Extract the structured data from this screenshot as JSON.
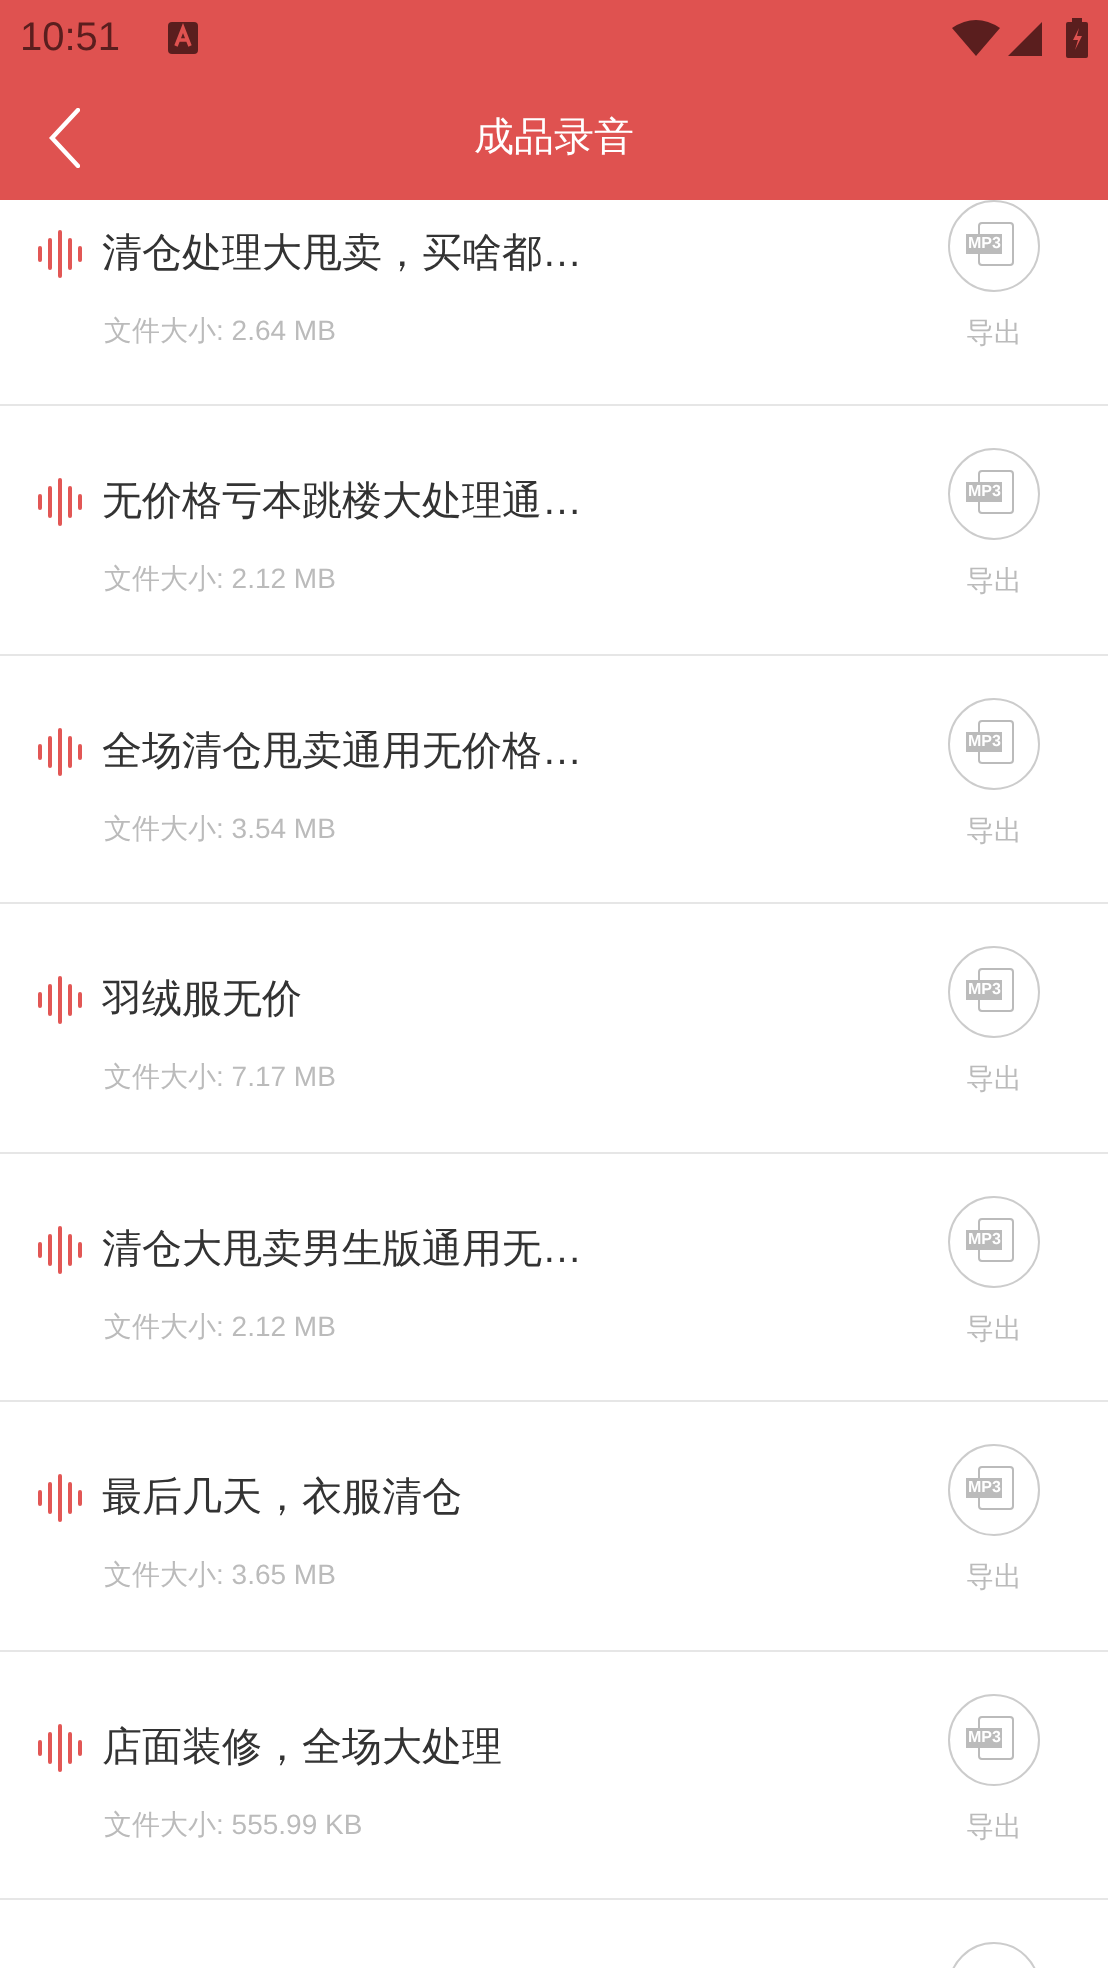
{
  "status_bar": {
    "time": "10:51"
  },
  "header": {
    "title": "成品录音"
  },
  "recordings": [
    {
      "title": "清仓处理大甩卖，买啥都…",
      "size": "文件大小: 2.64 MB",
      "icon_text": "MP3",
      "action": "导出"
    },
    {
      "title": "无价格亏本跳楼大处理通…",
      "size": "文件大小: 2.12 MB",
      "icon_text": "MP3",
      "action": "导出"
    },
    {
      "title": "全场清仓甩卖通用无价格…",
      "size": "文件大小: 3.54 MB",
      "icon_text": "MP3",
      "action": "导出"
    },
    {
      "title": "羽绒服无价",
      "size": "文件大小: 7.17 MB",
      "icon_text": "MP3",
      "action": "导出"
    },
    {
      "title": "清仓大甩卖男生版通用无…",
      "size": "文件大小: 2.12 MB",
      "icon_text": "MP3",
      "action": "导出"
    },
    {
      "title": "最后几天，衣服清仓",
      "size": "文件大小: 3.65 MB",
      "icon_text": "MP3",
      "action": "导出"
    },
    {
      "title": "店面装修，全场大处理",
      "size": "文件大小: 555.99 KB",
      "icon_text": "MP3",
      "action": "导出"
    }
  ]
}
